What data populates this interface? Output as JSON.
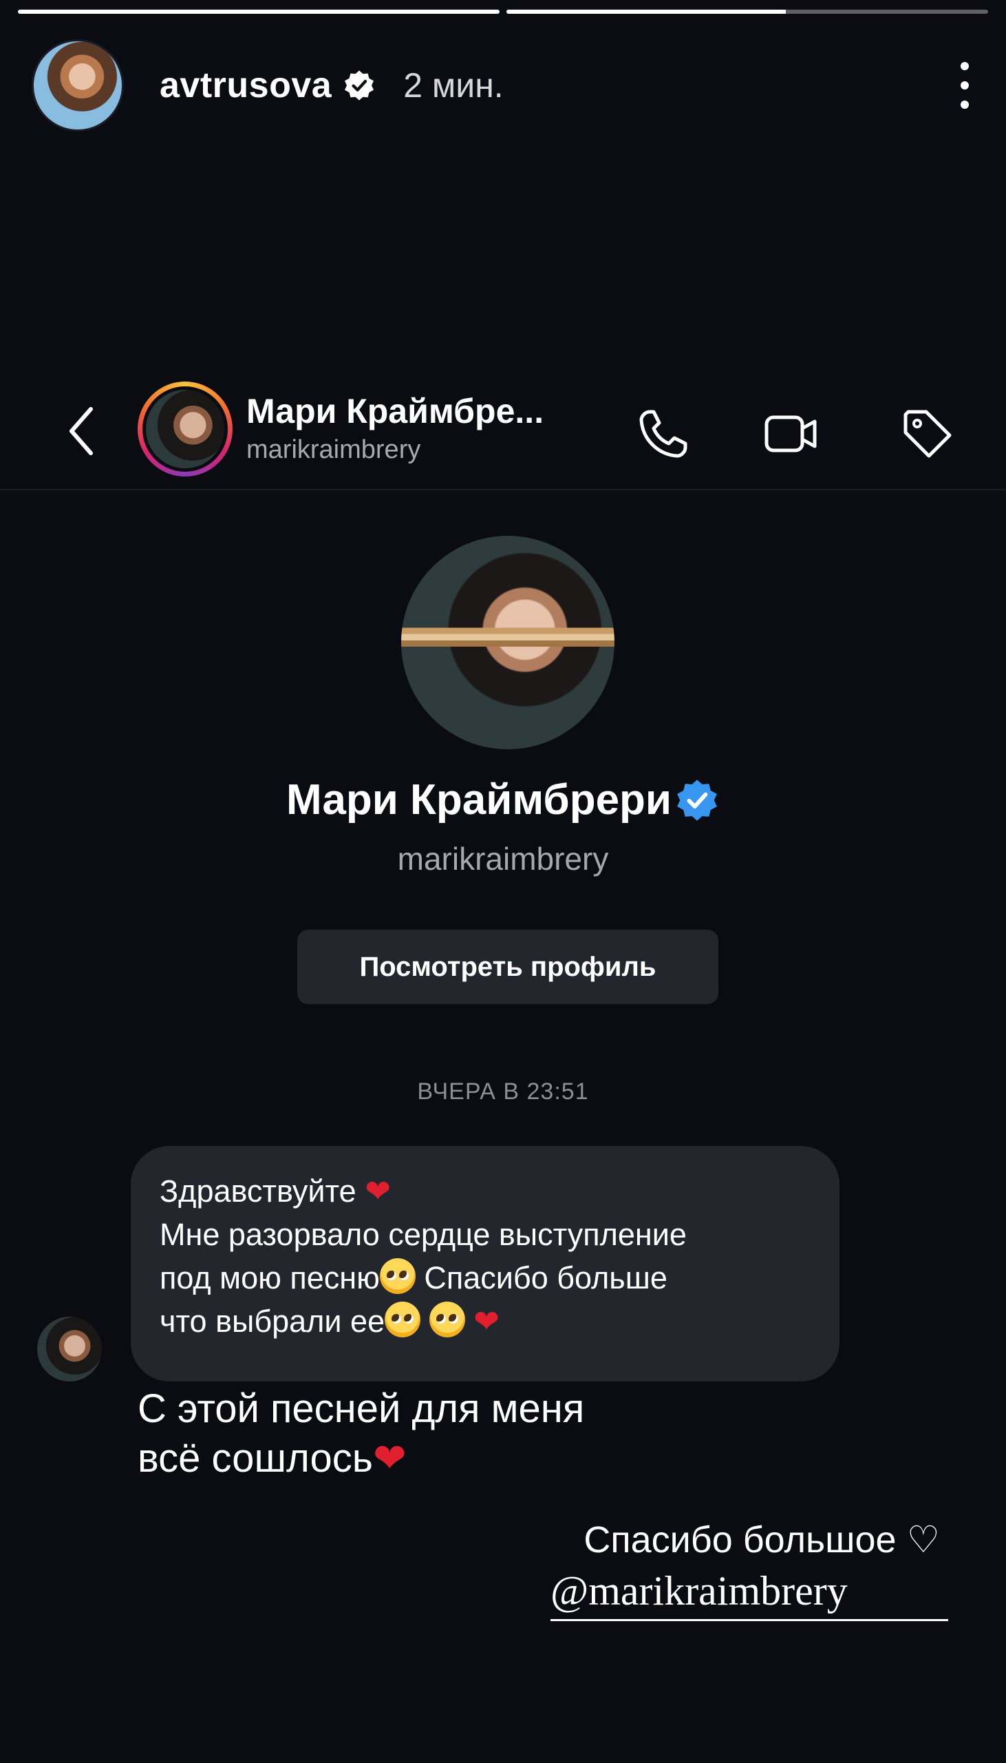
{
  "story": {
    "progress_segments": [
      1.0,
      0.58
    ],
    "username": "avtrusova",
    "time": "2 мин."
  },
  "dm_header": {
    "name": "Мари Краймбре...",
    "handle": "marikraimbrery"
  },
  "profile": {
    "name": "Мари Краймбрери",
    "handle": "marikraimbrery",
    "button_label": "Посмотреть профиль"
  },
  "chat": {
    "timestamp": "ВЧЕРА В 23:51",
    "message_lines": [
      "Здравствуйте",
      "Мне разорвало сердце выступление",
      "под мою песню",
      "Спасибо больше",
      "что выбрали ее"
    ]
  },
  "story_overlay": {
    "line1": "С этой песней для меня",
    "line2": "всё сошлось",
    "thanks": "Спасибо большое",
    "mention": "@marikraimbrery"
  },
  "colors": {
    "background": "#0b0c12",
    "bubble": "#24262e",
    "verified_blue": "#3797f0",
    "heart_red": "#e0202e"
  }
}
